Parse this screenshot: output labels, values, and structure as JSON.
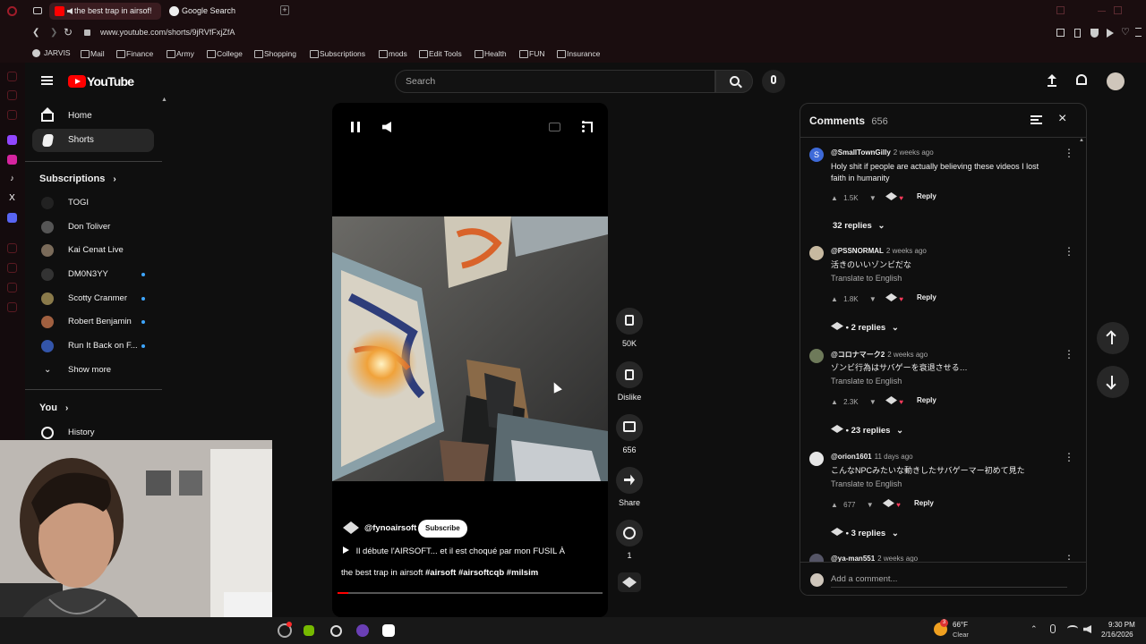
{
  "browser": {
    "tabs": [
      {
        "label": "the best trap in airsof!",
        "active": true
      },
      {
        "label": "Google Search",
        "active": false
      }
    ],
    "url": "www.youtube.com/shorts/9jRVfFxjZfA",
    "bookmarks": [
      "JARVIS",
      "Mail",
      "Finance",
      "Army",
      "College",
      "Shopping",
      "Subscriptions",
      "mods",
      "Edit Tools",
      "Health",
      "FUN",
      "Insurance"
    ]
  },
  "youtube": {
    "logo": "YouTube",
    "search_placeholder": "Search",
    "sidebar": {
      "items": [
        {
          "label": "Home",
          "icon": "home-icon"
        },
        {
          "label": "Shorts",
          "icon": "shorts-icon"
        }
      ],
      "subscriptions_title": "Subscriptions",
      "subscriptions": [
        {
          "name": "TOGI",
          "dot": false
        },
        {
          "name": "Don Toliver",
          "dot": false
        },
        {
          "name": "Kai Cenat Live",
          "dot": false
        },
        {
          "name": "DM0N3YY",
          "dot": true
        },
        {
          "name": "Scotty Cranmer",
          "dot": true
        },
        {
          "name": "Robert Benjamin",
          "dot": true
        },
        {
          "name": "Run It Back on F...",
          "dot": true
        }
      ],
      "show_more": "Show more",
      "you_title": "You",
      "history": "History"
    },
    "short": {
      "channel": "@fynoairsoft",
      "subscribe": "Subscribe",
      "title_line": "Il débute l'AIRSOFT... et il est choqué par mon FUSIL À",
      "description": "the best trap in airsoft",
      "hashtags": "#airsoft #airsoftcqb #milsim"
    },
    "actions": {
      "likes": "50K",
      "dislike": "Dislike",
      "comments": "656",
      "share": "Share",
      "remix": "1"
    },
    "comments_panel": {
      "title": "Comments",
      "count": "656",
      "add_placeholder": "Add a comment...",
      "comments": [
        {
          "user": "@SmallTownGilly",
          "when": "2 weeks ago",
          "text": "Holy shit if people are actually believing these videos I lost faith in humanity",
          "translate": "",
          "likes": "1.5K",
          "reply": "Reply",
          "replies": "32 replies"
        },
        {
          "user": "@PSSNORMAL",
          "when": "2 weeks ago",
          "text": "活きのいいゾンビだな",
          "translate": "Translate to English",
          "likes": "1.8K",
          "reply": "Reply",
          "replies": "• 2 replies"
        },
        {
          "user": "@コロナマーク2",
          "when": "2 weeks ago",
          "text": "ゾンビ行為はサバゲーを衰退させる…",
          "translate": "Translate to English",
          "likes": "2.3K",
          "reply": "Reply",
          "replies": "• 23 replies"
        },
        {
          "user": "@orion1601",
          "when": "11 days ago",
          "text": "こんなNPCみたいな動きしたサバゲーマー初めて見た",
          "translate": "Translate to English",
          "likes": "677",
          "reply": "Reply",
          "replies": "• 3 replies"
        },
        {
          "user": "@ya-man551",
          "when": "2 weeks ago",
          "text": "",
          "translate": "",
          "likes": "",
          "reply": "",
          "replies": ""
        }
      ]
    }
  },
  "taskbar": {
    "weather_temp": "66°F",
    "weather_desc": "Clear",
    "weather_badge": "3",
    "time": "9:30 PM",
    "date": "2/16/2026"
  },
  "colors": {
    "yt_red": "#ff0000",
    "link_blue": "#3ea6ff",
    "browser_bg": "#1a0d0f"
  }
}
